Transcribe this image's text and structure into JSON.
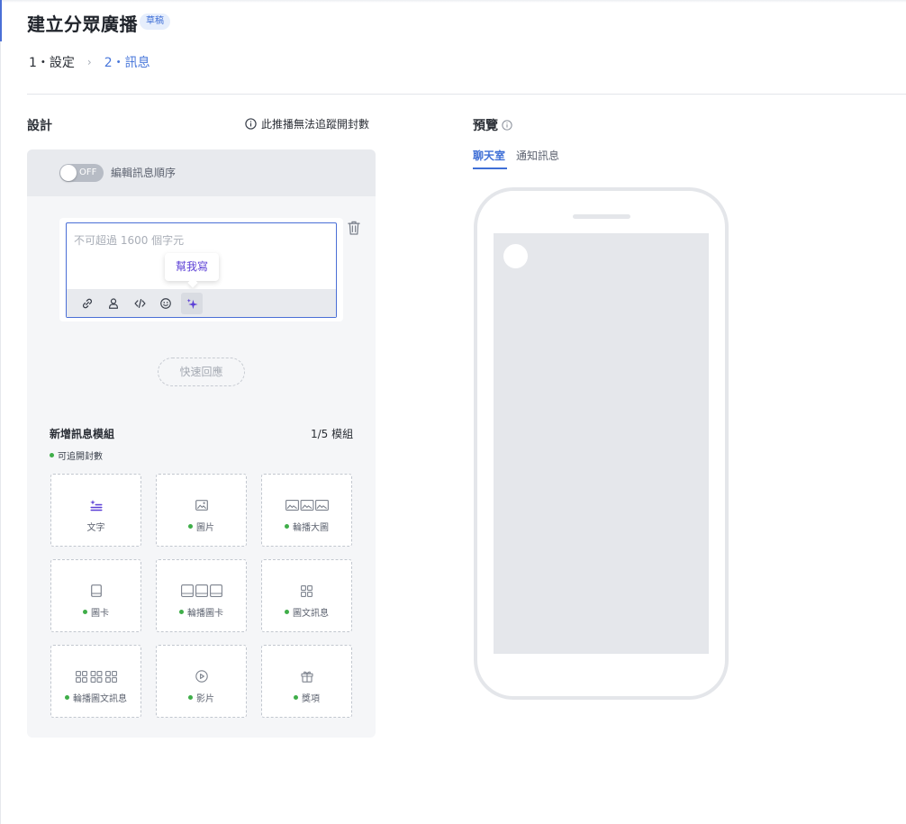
{
  "header": {
    "title": "建立分眾廣播",
    "badge": "草稿"
  },
  "steps": [
    {
      "label": "1・設定"
    },
    {
      "separator": "›"
    },
    {
      "label": "2・訊息"
    }
  ],
  "design": {
    "title": "設計",
    "notice": "此推播無法追蹤開封數",
    "toggle": {
      "state": "OFF",
      "label": "編輯訊息順序"
    },
    "editor": {
      "placeholder": "不可超過 1600 個字元",
      "tooltip": "幫我寫",
      "tools": [
        "link-icon",
        "user-icon",
        "code-icon",
        "emoji-icon",
        "sparkle-icon"
      ]
    },
    "quick_reply": "快速回應",
    "modules": {
      "title": "新增訊息模組",
      "count": "1/5 模組",
      "trackable_legend": "可追開封數",
      "items": [
        {
          "label": "文字",
          "icon": "text-icon",
          "trackable": false
        },
        {
          "label": "圖片",
          "icon": "image-icon",
          "trackable": true
        },
        {
          "label": "輪播大圖",
          "icon": "carousel-image-icon",
          "trackable": true
        },
        {
          "label": "圖卡",
          "icon": "card-icon",
          "trackable": true
        },
        {
          "label": "輪播圖卡",
          "icon": "carousel-card-icon",
          "trackable": true
        },
        {
          "label": "圖文訊息",
          "icon": "imagemap-icon",
          "trackable": true
        },
        {
          "label": "輪播圖文訊息",
          "icon": "carousel-imagemap-icon",
          "trackable": true
        },
        {
          "label": "影片",
          "icon": "video-icon",
          "trackable": true
        },
        {
          "label": "獎項",
          "icon": "gift-icon",
          "trackable": true
        }
      ]
    }
  },
  "preview": {
    "title": "預覽",
    "tabs": [
      {
        "label": "聊天室",
        "active": true
      },
      {
        "label": "通知訊息",
        "active": false
      }
    ]
  },
  "colors": {
    "accent": "#3f6fd6",
    "ai_purple": "#5b3fd6",
    "trackable_green": "#3fae49"
  }
}
